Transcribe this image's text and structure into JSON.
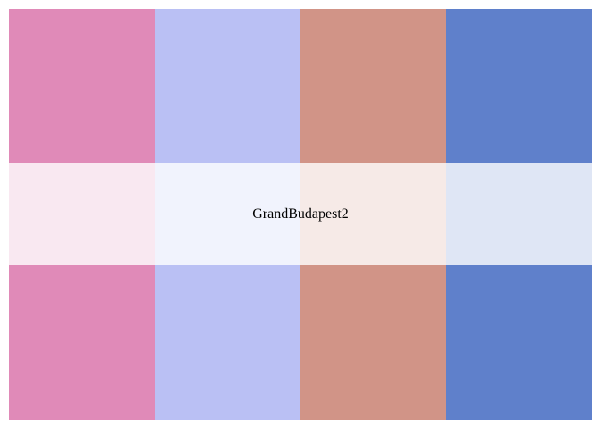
{
  "palette": {
    "name": "GrandBudapest2",
    "colors": [
      "#E08AB8",
      "#BAC0F4",
      "#D19487",
      "#5F80CB"
    ]
  }
}
